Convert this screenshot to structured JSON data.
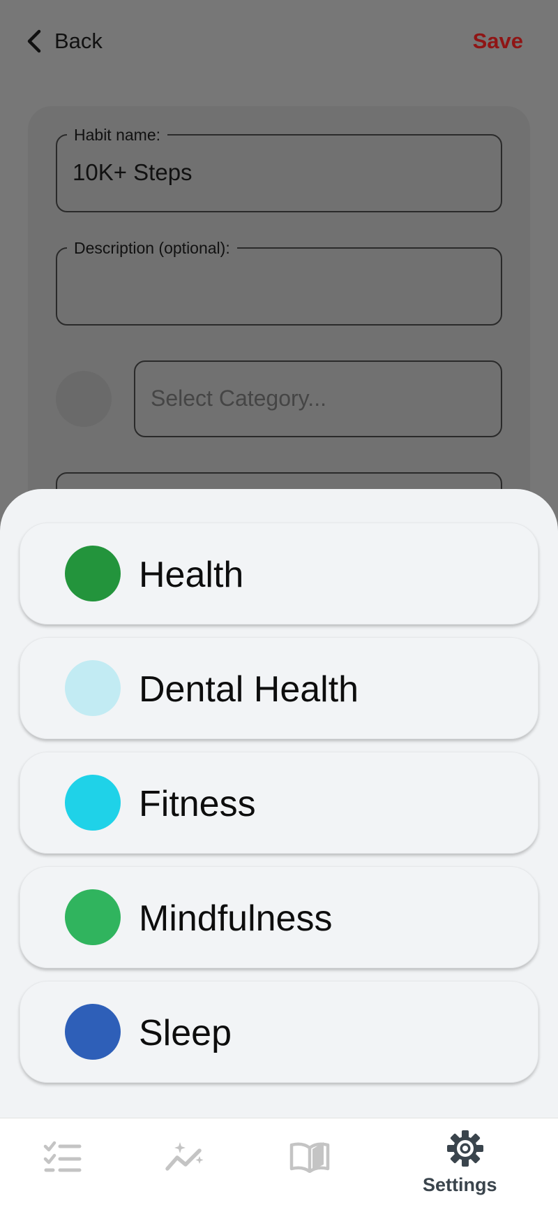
{
  "header": {
    "back_label": "Back",
    "save_label": "Save"
  },
  "form": {
    "name_label": "Habit name:",
    "name_value": "10K+ Steps",
    "description_label": "Description (optional):",
    "description_value": "",
    "category_placeholder": "Select Category..."
  },
  "categories": [
    {
      "label": "Health",
      "color": "#23943c"
    },
    {
      "label": "Dental Health",
      "color": "#c2ebf3"
    },
    {
      "label": "Fitness",
      "color": "#1fd2e8"
    },
    {
      "label": "Mindfulness",
      "color": "#30b45e"
    },
    {
      "label": "Sleep",
      "color": "#2e5fb8"
    }
  ],
  "tabs": [
    {
      "icon": "checklist-icon",
      "label": ""
    },
    {
      "icon": "trend-sparkle-icon",
      "label": ""
    },
    {
      "icon": "book-icon",
      "label": ""
    },
    {
      "icon": "gear-icon",
      "label": "Settings",
      "active": true
    }
  ],
  "colors": {
    "accent_save": "#8f1515",
    "tab_inactive": "#c4c4c4",
    "tab_active": "#3a444c"
  }
}
